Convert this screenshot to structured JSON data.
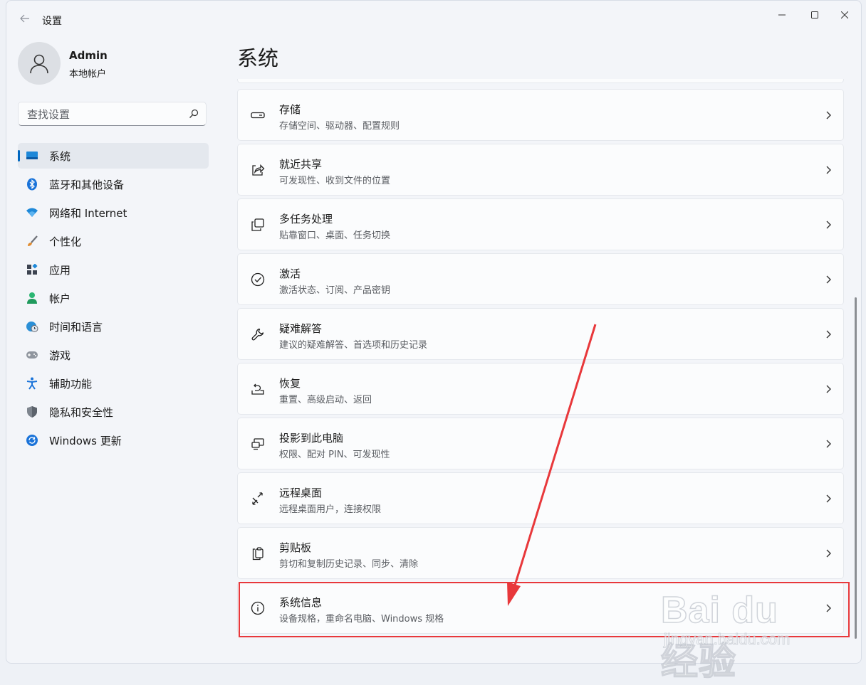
{
  "window": {
    "title": "设置"
  },
  "user": {
    "name": "Admin",
    "account_type": "本地帐户"
  },
  "search": {
    "placeholder": "查找设置"
  },
  "nav": [
    {
      "label": "系统",
      "icon": "display-icon",
      "active": true
    },
    {
      "label": "蓝牙和其他设备",
      "icon": "bluetooth-icon"
    },
    {
      "label": "网络和 Internet",
      "icon": "wifi-icon"
    },
    {
      "label": "个性化",
      "icon": "brush-icon"
    },
    {
      "label": "应用",
      "icon": "apps-icon"
    },
    {
      "label": "帐户",
      "icon": "person-icon"
    },
    {
      "label": "时间和语言",
      "icon": "globe-clock-icon"
    },
    {
      "label": "游戏",
      "icon": "gamepad-icon"
    },
    {
      "label": "辅助功能",
      "icon": "accessibility-icon"
    },
    {
      "label": "隐私和安全性",
      "icon": "shield-icon"
    },
    {
      "label": "Windows 更新",
      "icon": "refresh-icon"
    }
  ],
  "main": {
    "title": "系统",
    "cards": [
      {
        "title": "存储",
        "desc": "存储空间、驱动器、配置规则",
        "icon": "storage-drive-icon"
      },
      {
        "title": "就近共享",
        "desc": "可发现性、收到文件的位置",
        "icon": "share-icon"
      },
      {
        "title": "多任务处理",
        "desc": "贴靠窗口、桌面、任务切换",
        "icon": "multitask-icon"
      },
      {
        "title": "激活",
        "desc": "激活状态、订阅、产品密钥",
        "icon": "check-circle-icon"
      },
      {
        "title": "疑难解答",
        "desc": "建议的疑难解答、首选项和历史记录",
        "icon": "wrench-icon"
      },
      {
        "title": "恢复",
        "desc": "重置、高级启动、返回",
        "icon": "recovery-icon"
      },
      {
        "title": "投影到此电脑",
        "desc": "权限、配对 PIN、可发现性",
        "icon": "projection-icon"
      },
      {
        "title": "远程桌面",
        "desc": "远程桌面用户，连接权限",
        "icon": "remote-desktop-icon"
      },
      {
        "title": "剪贴板",
        "desc": "剪切和复制历史记录、同步、清除",
        "icon": "clipboard-icon"
      },
      {
        "title": "系统信息",
        "desc": "设备规格，重命名电脑、Windows 规格",
        "icon": "info-icon"
      }
    ]
  },
  "annotation": {
    "highlight_color": "#e8383b"
  },
  "watermark": {
    "logo": "Bai du 经验",
    "url": "jingyan.baidu.com"
  },
  "colors": {
    "accent": "#0067c0",
    "highlight": "#e8383b"
  }
}
